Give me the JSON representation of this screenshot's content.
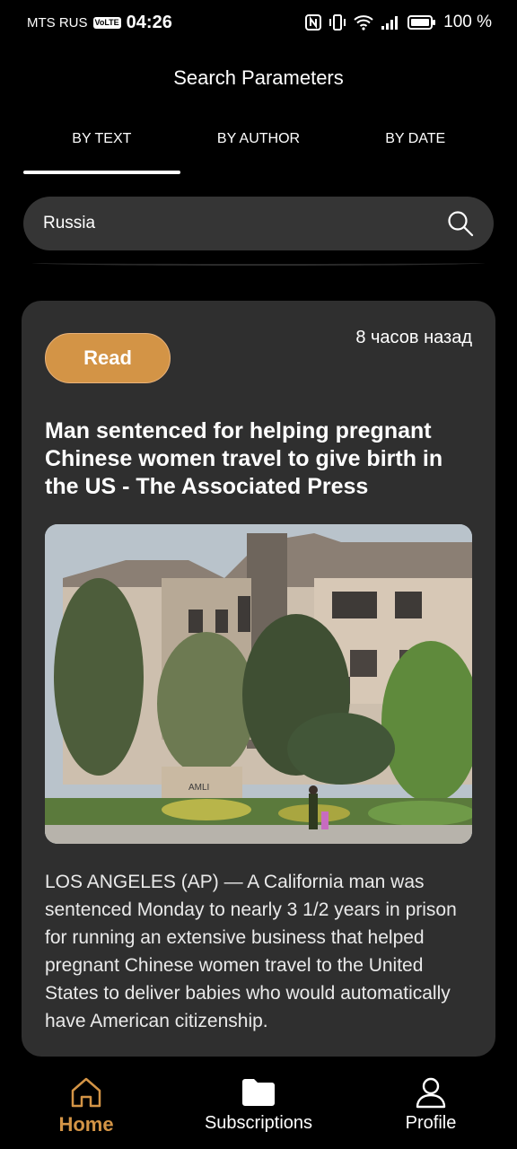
{
  "status": {
    "carrier": "MTS RUS",
    "volte": "VoLTE",
    "time": "04:26",
    "battery": "100 %"
  },
  "header": {
    "title": "Search Parameters"
  },
  "tabs": [
    {
      "label": "BY TEXT",
      "active": true
    },
    {
      "label": "BY AUTHOR",
      "active": false
    },
    {
      "label": "BY DATE",
      "active": false
    }
  ],
  "search": {
    "value": "Russia"
  },
  "article": {
    "read_label": "Read",
    "time_ago": "8 часов назад",
    "title": "Man sentenced for helping pregnant Chinese women travel to give birth in the US - The Associated Press",
    "body": "LOS ANGELES (AP) — A California man was sentenced Monday to nearly 3 1/2 years in prison for running an extensive business that helped pregnant Chinese women travel to the United States to deliver babies who would automatically have American citizenship.",
    "image_sign": "AMLI"
  },
  "nav": [
    {
      "label": "Home",
      "icon": "home-icon",
      "active": true
    },
    {
      "label": "Subscriptions",
      "icon": "folder-icon",
      "active": false
    },
    {
      "label": "Profile",
      "icon": "user-icon",
      "active": false
    }
  ],
  "colors": {
    "accent": "#d39446",
    "card": "#2f2f2f",
    "background": "#000000"
  }
}
